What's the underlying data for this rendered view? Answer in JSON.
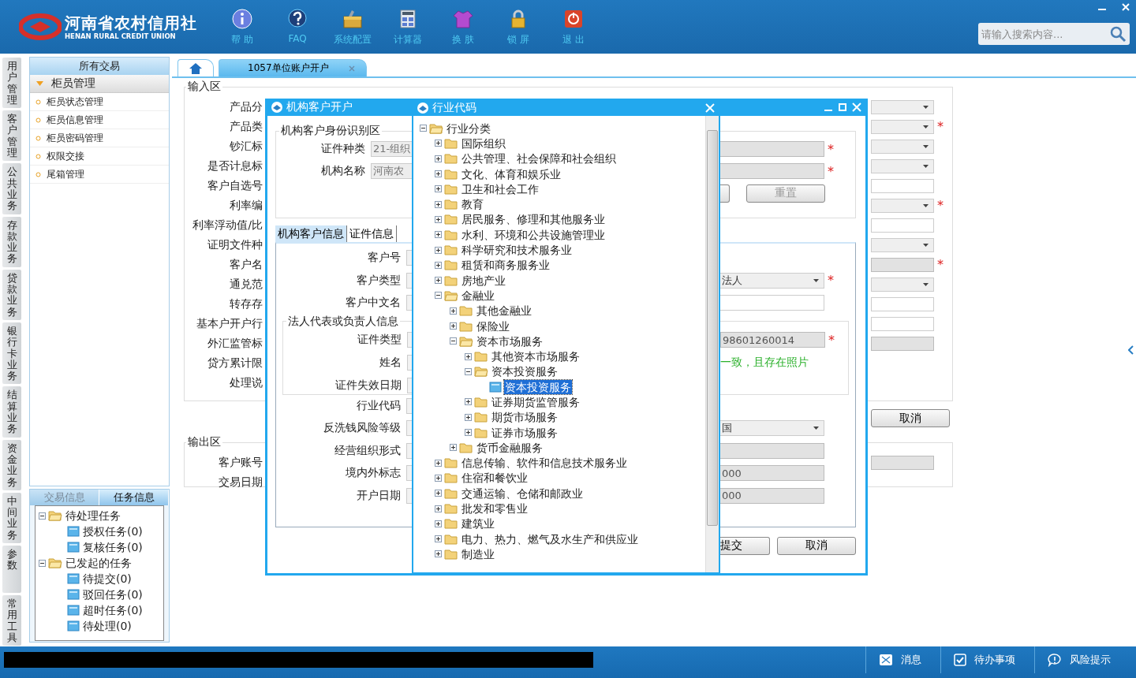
{
  "app": {
    "logo_title": "河南省农村信用社",
    "logo_subtitle": "HENAN RURAL CREDIT UNION"
  },
  "toolbar": [
    {
      "label": "帮 助",
      "kind": "help"
    },
    {
      "label": "FAQ",
      "kind": "faq"
    },
    {
      "label": "系统配置",
      "kind": "config"
    },
    {
      "label": "计算器",
      "kind": "calculator"
    },
    {
      "label": "换 肤",
      "kind": "skin"
    },
    {
      "label": "锁 屏",
      "kind": "lock"
    },
    {
      "label": "退 出",
      "kind": "exit"
    }
  ],
  "search": {
    "placeholder": "请输入搜索内容..."
  },
  "side_tabs": [
    "用户管理",
    "客户管理",
    "公共业务",
    "存款业务",
    "贷款业务",
    "银行卡业务",
    "结算业务",
    "资金业务",
    "中间业务",
    "参数",
    "常用工具"
  ],
  "nav_panel": {
    "title": "所有交易",
    "section": {
      "label": "柜员管理",
      "expanded": true
    },
    "items": [
      "柜员状态管理",
      "柜员信息管理",
      "柜员密码管理",
      "权限交接",
      "尾箱管理"
    ]
  },
  "task_panel": {
    "tabs": [
      {
        "label": "交易信息",
        "selected": false
      },
      {
        "label": "任务信息",
        "selected": true
      }
    ],
    "tree": [
      {
        "label": "待处理任务",
        "expanded": true,
        "children": [
          {
            "label": "授权任务(0)"
          },
          {
            "label": "复核任务(0)"
          }
        ]
      },
      {
        "label": "已发起的任务",
        "expanded": true,
        "children": [
          {
            "label": "待提交(0)"
          },
          {
            "label": "驳回任务(0)"
          },
          {
            "label": "超时任务(0)"
          },
          {
            "label": "待处理(0)"
          }
        ]
      }
    ]
  },
  "page_tabs": [
    {
      "kind": "home",
      "selected": false
    },
    {
      "kind": "page",
      "label": "1057单位账户开户",
      "selected": true
    }
  ],
  "form": {
    "input_title": "输入区",
    "input_rows": [
      {
        "label": "产品分",
        "control": {
          "kind": "select"
        }
      },
      {
        "label": "产品类",
        "control": {
          "kind": "select",
          "mark": "*"
        }
      },
      {
        "label": "钞汇标",
        "control": {
          "kind": "select"
        }
      },
      {
        "label": "是否计息标",
        "control": {
          "kind": "select"
        }
      },
      {
        "label": "客户自选号",
        "control": {
          "kind": "field",
          "disabled": false
        }
      },
      {
        "label": "利率编",
        "control": {
          "kind": "select",
          "mark": "*"
        }
      },
      {
        "label": "利率浮动值/比",
        "control": {
          "kind": "field",
          "disabled": false
        }
      },
      {
        "label": "证明文件种",
        "control": {
          "kind": "select"
        }
      },
      {
        "label": "客户名",
        "control": {
          "kind": "field",
          "mark": "*",
          "disabled": true
        }
      },
      {
        "label": "通兑范",
        "control": {
          "kind": "select"
        }
      },
      {
        "label": "转存存",
        "control": {
          "kind": "field",
          "disabled": false
        }
      },
      {
        "label": "基本户开户行",
        "control": {
          "kind": "field",
          "disabled": false
        }
      },
      {
        "label": "外汇监管标",
        "control": {
          "kind": "field",
          "disabled": true
        }
      },
      {
        "label": "贷方累计限"
      },
      {
        "label": "处理说"
      }
    ],
    "cancel_button": "取消",
    "output_title": "输出区",
    "output_rows": [
      {
        "label": "客户账号",
        "control": {
          "kind": "field",
          "disabled": true
        }
      },
      {
        "label": "交易日期"
      }
    ]
  },
  "customer_dialog": {
    "title": "机构客户开户",
    "id_section": {
      "title": "机构客户身份识别区",
      "rows": [
        {
          "label": "证件种类",
          "value": "21-组织",
          "mark": "*"
        },
        {
          "label": "机构名称",
          "value": "河南农",
          "mark": "*"
        }
      ],
      "reset_button": "重置"
    },
    "tabs": [
      {
        "label": "机构客户信息",
        "selected": true
      },
      {
        "label": "证件信息",
        "selected": false
      }
    ],
    "rows": [
      {
        "label": "客户号"
      },
      {
        "label": "客户类型",
        "right": {
          "kind": "select",
          "value": "法人",
          "mark": "*"
        }
      },
      {
        "label": "客户中文名",
        "right": {
          "kind": "field",
          "disabled": false
        }
      }
    ],
    "legal_group": {
      "title": "法人代表或负责人信息",
      "rows": [
        {
          "label": "证件类型",
          "right": {
            "kind": "field",
            "value": "98601260014",
            "mark": "*",
            "disabled": true
          }
        },
        {
          "label": "姓名",
          "note": "一致，且存在照片"
        },
        {
          "label": "证件失效日期"
        }
      ]
    },
    "rows2": [
      {
        "label": "行业代码"
      },
      {
        "label": "反洗钱风险等级",
        "right": {
          "kind": "select",
          "value": "国"
        }
      },
      {
        "label": "经营组织形式",
        "right": {
          "kind": "field",
          "disabled": true
        }
      },
      {
        "label": "境内外标志",
        "right": {
          "kind": "field",
          "value": "000",
          "disabled": true
        }
      },
      {
        "label": "开户日期",
        "right": {
          "kind": "field",
          "value": "000",
          "disabled": true
        }
      }
    ],
    "buttons": [
      "提交",
      "取消"
    ]
  },
  "industry_dialog": {
    "title": "行业代码",
    "tree": [
      {
        "label": "行业分类",
        "kind": "group",
        "expanded": true,
        "selected": false,
        "children": [
          {
            "label": "国际组织",
            "kind": "group",
            "expanded": false,
            "selected": false
          },
          {
            "label": "公共管理、社会保障和社会组织",
            "kind": "group",
            "expanded": false,
            "selected": false
          },
          {
            "label": "文化、体育和娱乐业",
            "kind": "group",
            "expanded": false,
            "selected": false
          },
          {
            "label": "卫生和社会工作",
            "kind": "group",
            "expanded": false,
            "selected": false
          },
          {
            "label": "教育",
            "kind": "group",
            "expanded": false,
            "selected": false
          },
          {
            "label": "居民服务、修理和其他服务业",
            "kind": "group",
            "expanded": false,
            "selected": false
          },
          {
            "label": "水利、环境和公共设施管理业",
            "kind": "group",
            "expanded": false,
            "selected": false
          },
          {
            "label": "科学研究和技术服务业",
            "kind": "group",
            "expanded": false,
            "selected": false
          },
          {
            "label": "租赁和商务服务业",
            "kind": "group",
            "expanded": false,
            "selected": false
          },
          {
            "label": "房地产业",
            "kind": "group",
            "expanded": false,
            "selected": false
          },
          {
            "label": "金融业",
            "kind": "group",
            "expanded": true,
            "selected": false,
            "children": [
              {
                "label": "其他金融业",
                "kind": "group",
                "expanded": false,
                "selected": false
              },
              {
                "label": "保险业",
                "kind": "group",
                "expanded": false,
                "selected": false
              },
              {
                "label": "资本市场服务",
                "kind": "group",
                "expanded": true,
                "selected": false,
                "children": [
                  {
                    "label": "其他资本市场服务",
                    "kind": "group",
                    "expanded": false,
                    "selected": false
                  },
                  {
                    "label": "资本投资服务",
                    "kind": "group",
                    "expanded": true,
                    "selected": false,
                    "children": [
                      {
                        "label": "资本投资服务",
                        "kind": "leaf",
                        "selected": true
                      }
                    ]
                  },
                  {
                    "label": "证券期货监管服务",
                    "kind": "group",
                    "expanded": false,
                    "selected": false
                  },
                  {
                    "label": "期货市场服务",
                    "kind": "group",
                    "expanded": false,
                    "selected": false
                  },
                  {
                    "label": "证券市场服务",
                    "kind": "group",
                    "expanded": false,
                    "selected": false
                  }
                ]
              },
              {
                "label": "货币金融服务",
                "kind": "group",
                "expanded": false,
                "selected": false
              }
            ]
          },
          {
            "label": "信息传输、软件和信息技术服务业",
            "kind": "group",
            "expanded": false,
            "selected": false
          },
          {
            "label": "住宿和餐饮业",
            "kind": "group",
            "expanded": false,
            "selected": false
          },
          {
            "label": "交通运输、仓储和邮政业",
            "kind": "group",
            "expanded": false,
            "selected": false
          },
          {
            "label": "批发和零售业",
            "kind": "group",
            "expanded": false,
            "selected": false
          },
          {
            "label": "建筑业",
            "kind": "group",
            "expanded": false,
            "selected": false
          },
          {
            "label": "电力、热力、燃气及水生产和供应业",
            "kind": "group",
            "expanded": false,
            "selected": false
          },
          {
            "label": "制造业",
            "kind": "group",
            "expanded": false,
            "selected": false
          }
        ]
      }
    ]
  },
  "status_bar": [
    {
      "label": "消息",
      "kind": "message"
    },
    {
      "label": "待办事项",
      "kind": "todo"
    },
    {
      "label": "风险提示",
      "kind": "risk"
    }
  ]
}
